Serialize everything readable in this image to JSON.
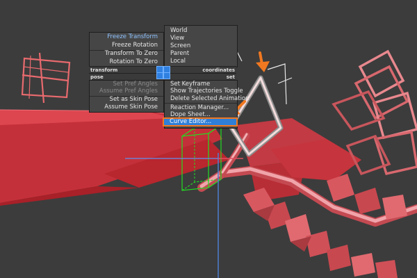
{
  "quad_menu": {
    "top_left": {
      "items": [
        {
          "label": "Freeze Transform",
          "state": "highlighted"
        },
        {
          "label": "Freeze Rotation",
          "state": "normal"
        },
        {
          "label": "Transform To Zero",
          "state": "normal"
        },
        {
          "label": "Rotation To Zero",
          "state": "normal"
        }
      ],
      "footer_label": "transform"
    },
    "top_right": {
      "items": [
        "World",
        "View",
        "Screen",
        "Parent",
        "Local"
      ],
      "footer_label": "coordinates"
    },
    "bottom_left": {
      "header_label": "pose",
      "items": [
        {
          "label": "Set Pref Angles",
          "state": "disabled"
        },
        {
          "label": "Assume Pref Angles",
          "state": "disabled"
        },
        {
          "label": "Set as Skin Pose",
          "state": "normal"
        },
        {
          "label": "Assume Skin Pose",
          "state": "normal"
        }
      ]
    },
    "bottom_right": {
      "header_label": "set",
      "items": [
        {
          "label": "Set Keyframe",
          "state": "normal"
        },
        {
          "label": "Show Trajectories Toggle",
          "state": "normal"
        },
        {
          "label": "Delete Selected Animation",
          "state": "normal"
        },
        {
          "label": "Reaction Manager...",
          "state": "normal"
        },
        {
          "label": "Dope Sheet...",
          "state": "normal"
        },
        {
          "label": "Curve Editor...",
          "state": "selected"
        }
      ]
    }
  },
  "annotation_arrows": {
    "color": "#f07820",
    "count": 2
  },
  "colors": {
    "background": "#3c3c3c",
    "geometry": "#e8606a",
    "menu_bg": "#464646",
    "selection": "#2f7fd8",
    "selection_border": "#f07820",
    "gizmo_green": "#22dd22",
    "gizmo_blue": "#4f7fd0"
  }
}
